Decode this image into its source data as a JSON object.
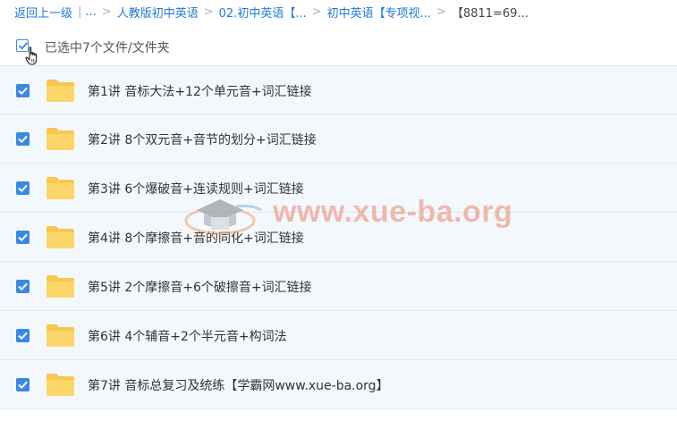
{
  "breadcrumb": {
    "back": "返回上一级",
    "ellipsis": "...",
    "items": [
      "人教版初中英语",
      "02.初中英语【...",
      "初中英语【专项视..."
    ],
    "current": "【8811=69..."
  },
  "selection": {
    "count_label": "已选中7个文件/文件夹",
    "all_checked": true
  },
  "files": [
    {
      "name": "第1讲 音标大法+12个单元音+词汇链接",
      "checked": true
    },
    {
      "name": "第2讲 8个双元音+音节的划分+词汇链接",
      "checked": true
    },
    {
      "name": "第3讲 6个爆破音+连读规则+词汇链接",
      "checked": true
    },
    {
      "name": "第4讲 8个摩擦音+音的同化+词汇链接",
      "checked": true
    },
    {
      "name": "第5讲 2个摩擦音+6个破擦音+词汇链接",
      "checked": true
    },
    {
      "name": "第6讲 4个辅音+2个半元音+构词法",
      "checked": true
    },
    {
      "name": "第7讲 音标总复习及统练【学霸网www.xue-ba.org】",
      "checked": true
    }
  ],
  "watermark": {
    "text": "www.xue-ba.org"
  },
  "colors": {
    "link": "#1e7ad6",
    "checkbox": "#3b88e3",
    "row_bg": "#f3f8fd",
    "folder": "#fcd261",
    "watermark": "#ef7a60"
  }
}
